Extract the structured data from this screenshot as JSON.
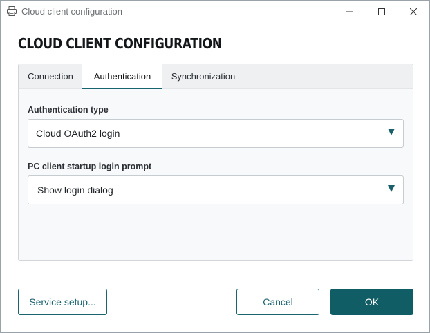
{
  "window": {
    "title": "Cloud client configuration",
    "app_icon": "printer-icon",
    "controls": [
      "minimize-icon",
      "maximize-icon",
      "close-icon"
    ]
  },
  "page": {
    "title": "CLOUD CLIENT CONFIGURATION"
  },
  "tabs": [
    {
      "label": "Connection",
      "selected": false
    },
    {
      "label": "Authentication",
      "selected": true
    },
    {
      "label": "Synchronization",
      "selected": false
    }
  ],
  "form": {
    "auth_type": {
      "label": "Authentication type",
      "value": "Cloud OAuth2 login"
    },
    "startup_prompt": {
      "label": "PC client startup login prompt",
      "value": "Show login dialog"
    }
  },
  "buttons": {
    "service_setup": "Service setup...",
    "cancel": "Cancel",
    "ok": "OK"
  },
  "colors": {
    "accent": "#1a6470",
    "primary_button": "#105d66",
    "panel_background": "#f8f9fb"
  }
}
